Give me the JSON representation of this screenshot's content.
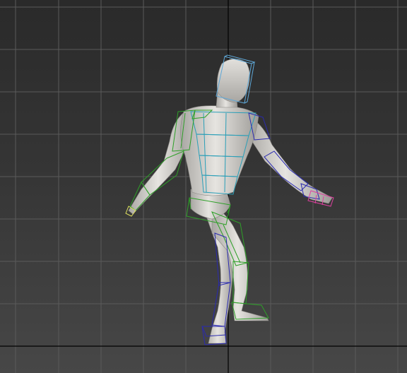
{
  "viewport": {
    "shading": "smooth",
    "grid_visible": true,
    "colors": {
      "grid_line": "#5a5a5a",
      "grid_axis": "#000000",
      "body_skin": "#d6d4d0",
      "biped_head_rig": "#5fa8d8",
      "biped_spine_rig": "#2a9fb8",
      "biped_left_rig": "#2ea028",
      "biped_right_rig": "#2a2ab0",
      "biped_hand_left": "#e0e060",
      "biped_hand_right": "#e040a0"
    }
  },
  "scene": {
    "object": "human-mesh",
    "rig": "biped-skeleton",
    "icons": [
      "figure-icon"
    ]
  }
}
